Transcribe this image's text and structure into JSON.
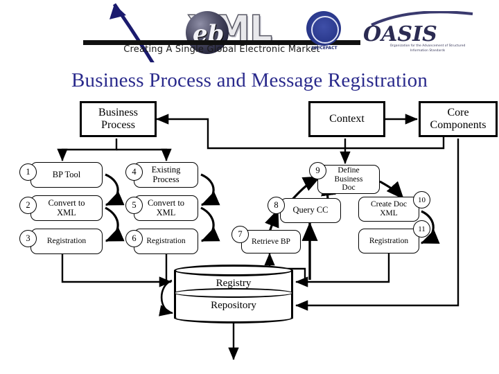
{
  "header": {
    "brand_eb": "eb",
    "brand_xml": "XML",
    "tagline": "Creating A Single Global Electronic Market",
    "un_caption": "UN/CEFACT",
    "oasis_word": "OASIS",
    "oasis_sub": "Organization for the Advancement of Structured Information Standards"
  },
  "title": "Business Process and Message Registration",
  "top_boxes": [
    {
      "id": "business-process",
      "label": "Business\nProcess"
    },
    {
      "id": "context",
      "label": "Context"
    },
    {
      "id": "core-components",
      "label": "Core\nComponents"
    }
  ],
  "steps": [
    {
      "num": "1",
      "label": "BP Tool",
      "column": "left"
    },
    {
      "num": "2",
      "label": "Convert to\nXML",
      "column": "left"
    },
    {
      "num": "3",
      "label": "Registration",
      "column": "left"
    },
    {
      "num": "4",
      "label": "Existing\nProcess",
      "column": "second"
    },
    {
      "num": "5",
      "label": "Convert to\nXML",
      "column": "second"
    },
    {
      "num": "6",
      "label": "Registration",
      "column": "second"
    },
    {
      "num": "7",
      "label": "Retrieve BP",
      "column": "third"
    },
    {
      "num": "8",
      "label": "Query CC",
      "column": "third"
    },
    {
      "num": "9",
      "label": "Define\nBusiness\nDoc",
      "column": "third"
    },
    {
      "num": "10",
      "label": "Create Doc\nXML",
      "column": "fourth"
    },
    {
      "num": "11",
      "label": "Registration",
      "column": "fourth"
    }
  ],
  "datastore": {
    "registry": "Registry",
    "repository": "Repository"
  },
  "colors": {
    "title": "#2a2a8c",
    "stroke": "#000000",
    "background": "#ffffff",
    "un_blue": "#2c3b8f",
    "oasis_ink": "#2b2b52"
  }
}
